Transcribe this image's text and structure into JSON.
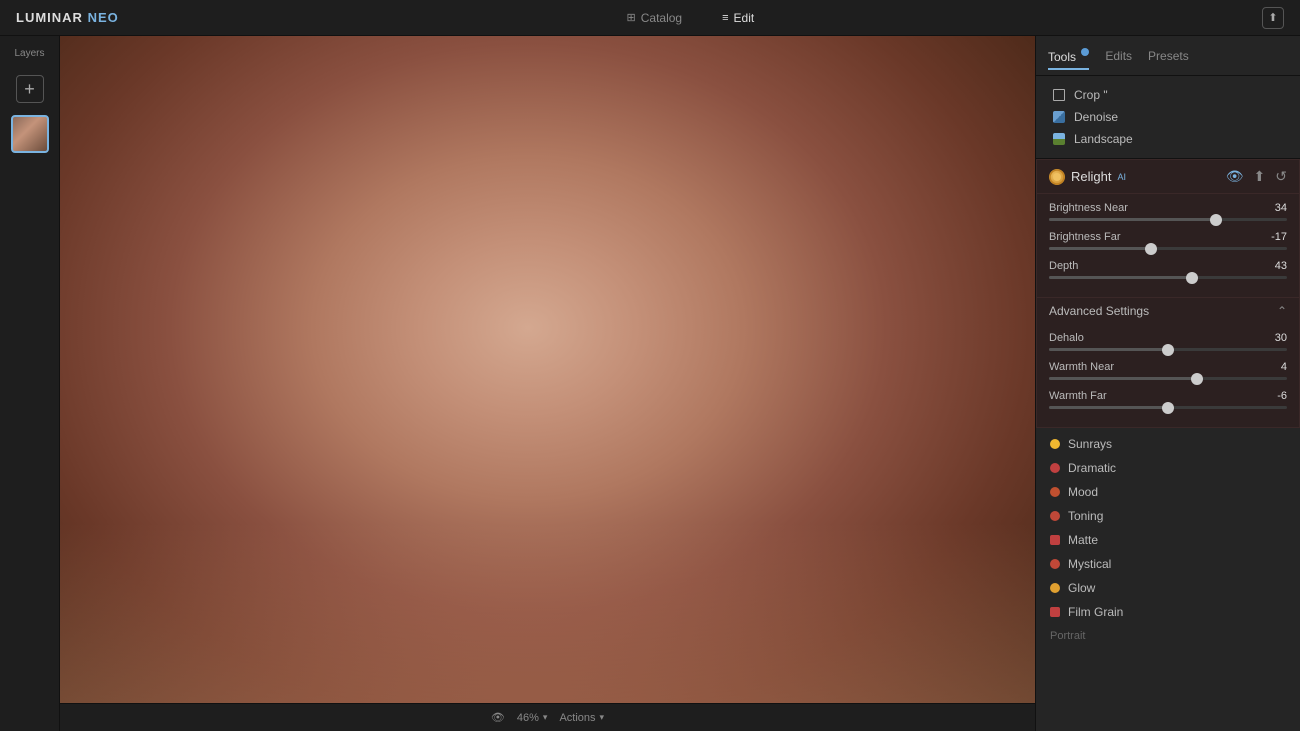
{
  "app": {
    "name": "LUMINAR",
    "name_neo": "NEO"
  },
  "topbar": {
    "nav": [
      {
        "id": "catalog",
        "label": "Catalog",
        "icon": "⊞",
        "active": false
      },
      {
        "id": "edit",
        "label": "Edit",
        "icon": "≡",
        "active": true
      }
    ]
  },
  "left_sidebar": {
    "layers_label": "Layers",
    "add_button": "+"
  },
  "right_panel": {
    "tabs": [
      {
        "id": "tools",
        "label": "Tools",
        "active": true,
        "badge": true
      },
      {
        "id": "edits",
        "label": "Edits",
        "active": false,
        "badge": false
      },
      {
        "id": "presets",
        "label": "Presets",
        "active": false,
        "badge": false
      }
    ],
    "top_tools": [
      {
        "id": "crop",
        "label": "Crop \"",
        "type": "crop"
      },
      {
        "id": "denoise",
        "label": "Denoise",
        "type": "denoise"
      },
      {
        "id": "landscape",
        "label": "Landscape",
        "type": "landscape"
      }
    ],
    "relight": {
      "title": "Relight",
      "ai_badge": "AI",
      "sliders": [
        {
          "id": "brightness_near",
          "label": "Brightness Near",
          "value": 34,
          "percent": 70
        },
        {
          "id": "brightness_far",
          "label": "Brightness Far",
          "value": -17,
          "percent": 43
        },
        {
          "id": "depth",
          "label": "Depth",
          "value": 43,
          "percent": 60
        }
      ],
      "advanced_settings_label": "Advanced Settings",
      "advanced_sliders": [
        {
          "id": "dehalo",
          "label": "Dehalo",
          "value": 30,
          "percent": 50
        },
        {
          "id": "warmth_near",
          "label": "Warmth Near",
          "value": 4,
          "percent": 62
        },
        {
          "id": "warmth_far",
          "label": "Warmth Far",
          "value": -6,
          "percent": 50
        }
      ]
    },
    "tools_list": [
      {
        "id": "sunrays",
        "label": "Sunrays",
        "color": "#f0b830",
        "section": ""
      },
      {
        "id": "dramatic",
        "label": "Dramatic",
        "color": "#c04040",
        "section": ""
      },
      {
        "id": "mood",
        "label": "Mood",
        "color": "#c05030",
        "section": ""
      },
      {
        "id": "toning",
        "label": "Toning",
        "color": "#c04838",
        "section": ""
      },
      {
        "id": "matte",
        "label": "Matte",
        "color": "#c04040",
        "section": ""
      },
      {
        "id": "mystical",
        "label": "Mystical",
        "color": "#c04838",
        "section": ""
      },
      {
        "id": "glow",
        "label": "Glow",
        "color": "#e0a030",
        "section": ""
      },
      {
        "id": "film_grain",
        "label": "Film Grain",
        "color": "#c04040",
        "section": ""
      }
    ],
    "section_label": "Portrait"
  },
  "bottom_bar": {
    "eye_icon": "👁",
    "zoom": "46%",
    "actions": "Actions"
  }
}
